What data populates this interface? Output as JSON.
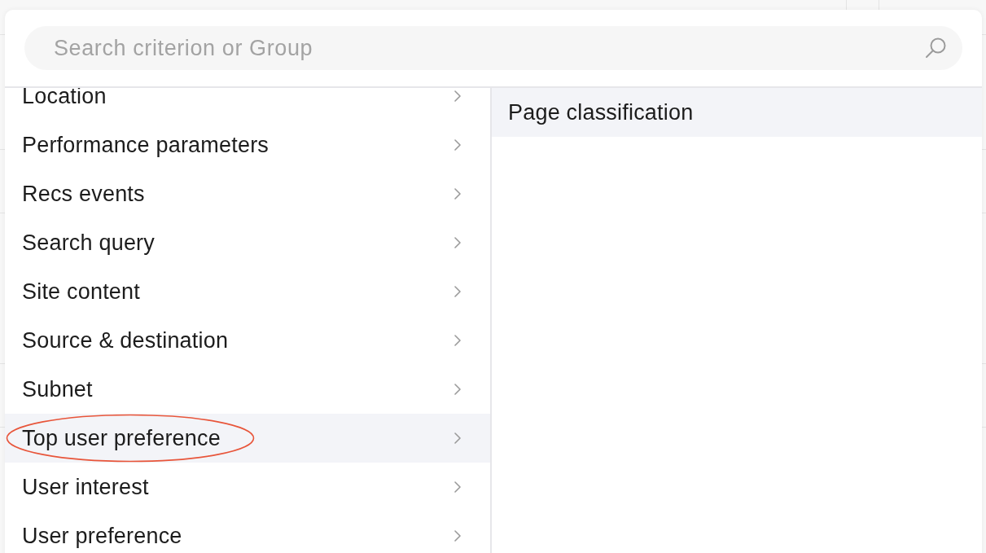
{
  "search": {
    "placeholder": "Search criterion or Group"
  },
  "groups": [
    {
      "label": "Location",
      "selected": false,
      "circled": false
    },
    {
      "label": "Performance parameters",
      "selected": false,
      "circled": false
    },
    {
      "label": "Recs events",
      "selected": false,
      "circled": false
    },
    {
      "label": "Search query",
      "selected": false,
      "circled": false
    },
    {
      "label": "Site content",
      "selected": false,
      "circled": false
    },
    {
      "label": "Source & destination",
      "selected": false,
      "circled": false
    },
    {
      "label": "Subnet",
      "selected": false,
      "circled": false
    },
    {
      "label": "Top user preference",
      "selected": true,
      "circled": true
    },
    {
      "label": "User interest",
      "selected": false,
      "circled": false
    },
    {
      "label": "User preference",
      "selected": false,
      "circled": false
    }
  ],
  "subgroups": [
    {
      "label": "Page classification",
      "selected": true
    }
  ]
}
